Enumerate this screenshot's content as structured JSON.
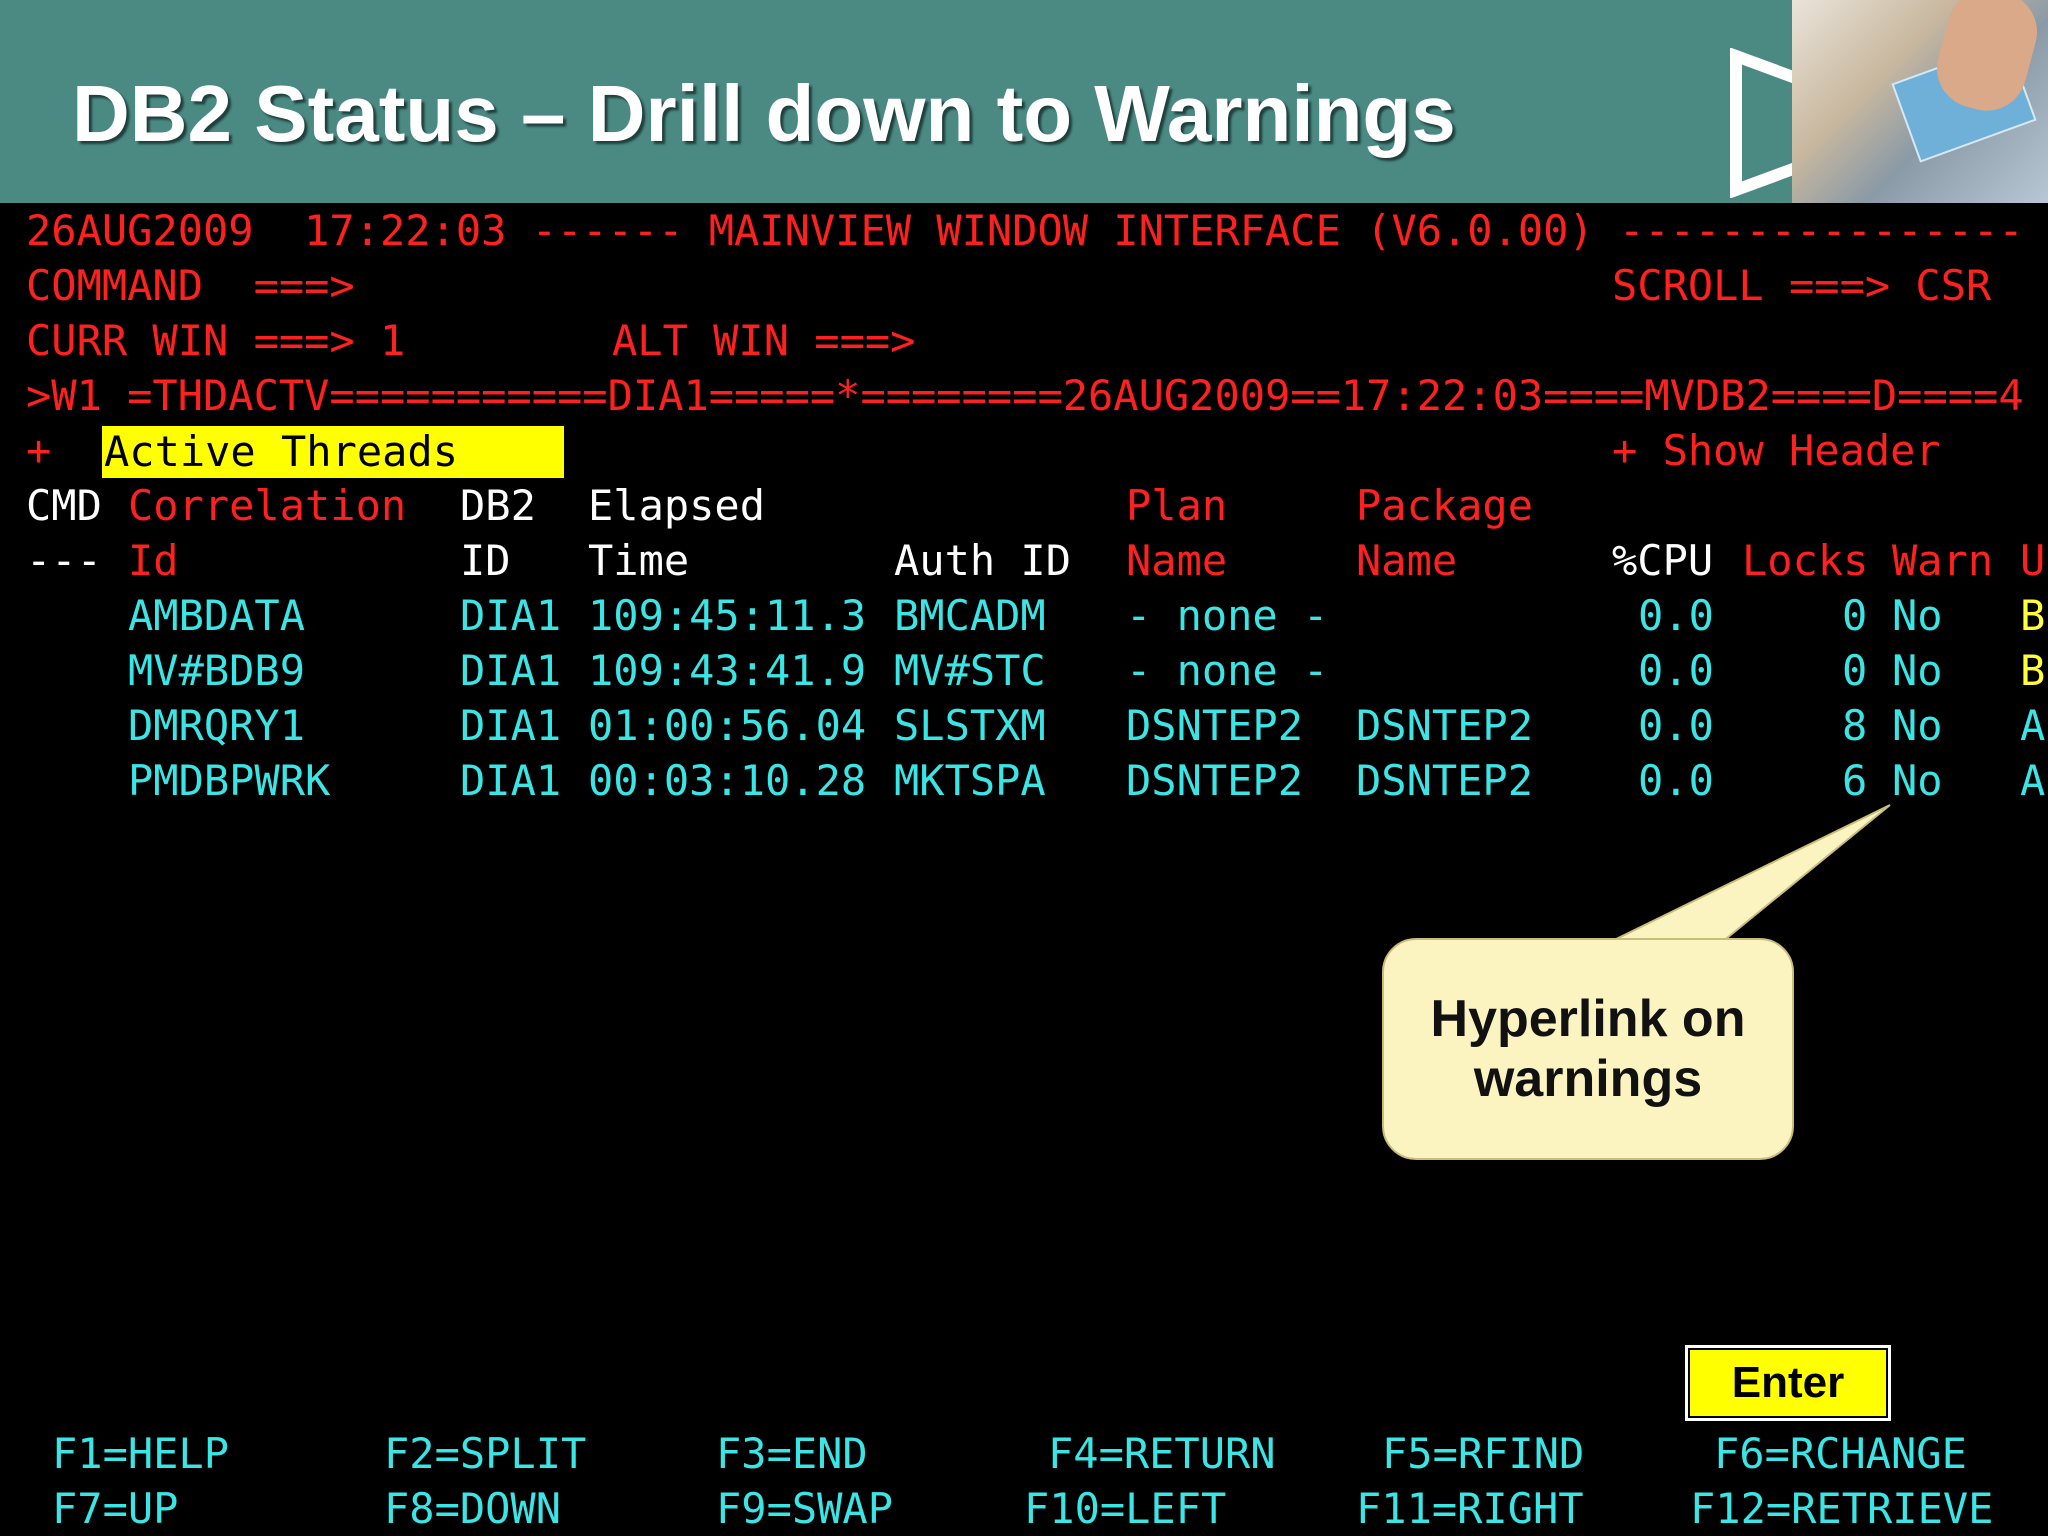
{
  "slide": {
    "title": "DB2 Status – Drill down to Warnings"
  },
  "terminal": {
    "line1": "26AUG2009  17:22:03 ------ MAINVIEW WINDOW INTERFACE (V6.0.00) ----------------",
    "command_label": "COMMAND  ===>",
    "scroll_label": "SCROLL ===> CSR",
    "curr_win": "CURR WIN ===> 1",
    "alt_win": "ALT WIN ===>",
    "window_line": ">W1 =THDACTV===========DIA1=====*========26AUG2009==17:22:03====MVDB2====D====4",
    "plus": "+",
    "active_threads": "Active Threads",
    "show_header": "+ Show Header",
    "headers": {
      "cmd": "CMD",
      "cmd_dash": "---",
      "corr1": "Correlation",
      "corr2": "Id",
      "db2_1": "DB2",
      "db2_2": "ID",
      "elapsed1": "Elapsed",
      "elapsed2": "Time",
      "auth": "Auth ID",
      "plan1": "Plan",
      "plan2": "Name",
      "package1": "Package",
      "package2": "Name",
      "cpu": "%CPU",
      "locks": "Locks",
      "warn": "Warn",
      "extra": "U"
    },
    "rows": [
      {
        "corr": "AMBDATA",
        "db2": "DIA1",
        "elapsed": "109:45:11.3",
        "auth": "BMCADM",
        "plan": "- none -",
        "package": "",
        "cpu": "0.0",
        "locks": "0",
        "warn": "No",
        "extra": "B"
      },
      {
        "corr": "MV#BDB9",
        "db2": "DIA1",
        "elapsed": "109:43:41.9",
        "auth": "MV#STC",
        "plan": "- none -",
        "package": "",
        "cpu": "0.0",
        "locks": "0",
        "warn": "No",
        "extra": "B"
      },
      {
        "corr": "DMRQRY1",
        "db2": "DIA1",
        "elapsed": "01:00:56.04",
        "auth": "SLSTXM",
        "plan": "DSNTEP2",
        "package": "DSNTEP2",
        "cpu": "0.0",
        "locks": "8",
        "warn": "No",
        "extra": "A"
      },
      {
        "corr": "PMDBPWRK",
        "db2": "DIA1",
        "elapsed": "00:03:10.28",
        "auth": "MKTSPA",
        "plan": "DSNTEP2",
        "package": "DSNTEP2",
        "cpu": "0.0",
        "locks": "6",
        "warn": "No",
        "extra": "A"
      }
    ],
    "fkeys_row1": [
      "F1=HELP",
      "F2=SPLIT",
      "F3=END",
      "F4=RETURN",
      "F5=RFIND",
      "F6=RCHANGE"
    ],
    "fkeys_row2": [
      "F7=UP",
      "F8=DOWN",
      "F9=SWAP",
      "F10=LEFT",
      "F11=RIGHT",
      "F12=RETRIEVE"
    ]
  },
  "callout": {
    "line1": "Hyperlink on",
    "line2": "warnings"
  },
  "enter_button": "Enter",
  "icons": {
    "play": "play-icon"
  },
  "colors": {
    "banner": "#4a8a83",
    "terminal_bg": "#000000",
    "red": "#ff2020",
    "cyan": "#3ae5e5",
    "highlight": "#ffff00"
  }
}
